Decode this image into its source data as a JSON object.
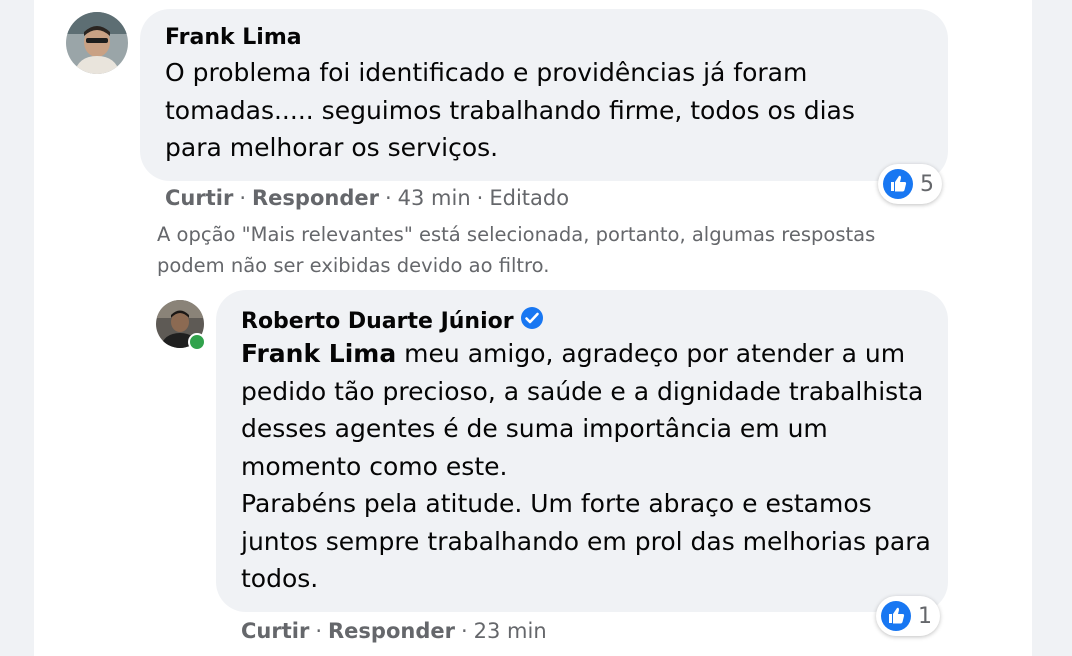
{
  "comments": [
    {
      "author": "Frank Lima",
      "text": "O problema foi identificado e providências já foram tomadas..... seguimos trabalhando firme, todos os dias para melhorar os serviços.",
      "actions": {
        "like": "Curtir",
        "reply": "Responder",
        "time": "43 min",
        "edited": "Editado"
      },
      "reaction": {
        "icon": "thumbs-up-icon",
        "count": "5",
        "color": "#1877f2"
      }
    }
  ],
  "filter_notice": "A opção \"Mais relevantes\" está selecionada, portanto, algumas respostas podem não ser exibidas devido ao filtro.",
  "replies": [
    {
      "author": "Roberto Duarte Júnior",
      "verified": true,
      "online": true,
      "mention": "Frank Lima",
      "text_line1": " meu amigo, agradeço por atender a um pedido tão precioso, a saúde e a dignidade trabalhista desses agentes é de suma importância em um momento como este.",
      "text_line2": "Parabéns pela atitude. Um forte abraço e estamos juntos sempre trabalhando em prol das melhorias para todos.",
      "actions": {
        "like": "Curtir",
        "reply": "Responder",
        "time": "23 min"
      },
      "reaction": {
        "icon": "thumbs-up-icon",
        "count": "1",
        "color": "#1877f2"
      }
    }
  ],
  "separator": "·"
}
